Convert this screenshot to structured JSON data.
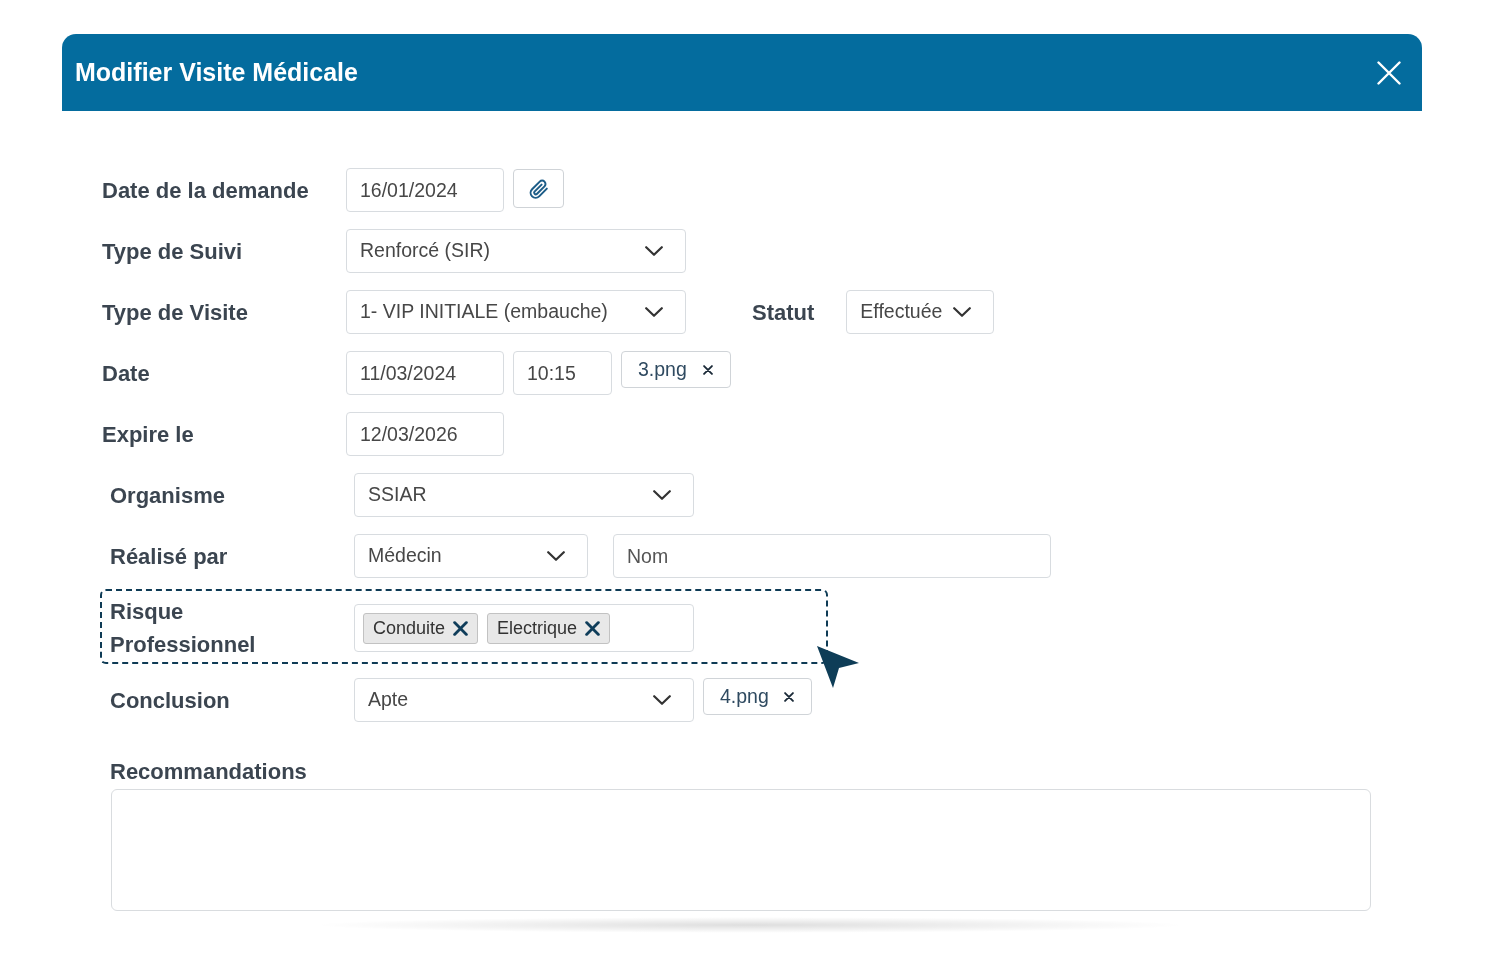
{
  "dialog": {
    "title": "Modifier Visite Médicale"
  },
  "form": {
    "rows": [
      {
        "label": "Date de la demande",
        "highlighted": false,
        "controls": [
          {
            "kind": "date",
            "value": "16/01/2024"
          },
          {
            "kind": "attach"
          }
        ]
      },
      {
        "label": "Type de Suivi",
        "highlighted": false,
        "controls": [
          {
            "kind": "select",
            "value": "Renforcé (SIR)"
          }
        ]
      },
      {
        "label": "Type de Visite",
        "highlighted": false,
        "controls": [
          {
            "kind": "select",
            "value": "1- VIP INITIALE (embauche)"
          },
          {
            "kind": "label",
            "text": "Statut"
          },
          {
            "kind": "select",
            "value": "Effectuée"
          }
        ]
      },
      {
        "label": "Date",
        "highlighted": false,
        "controls": [
          {
            "kind": "date",
            "value": "11/03/2024"
          },
          {
            "kind": "time",
            "value": "10:15"
          },
          {
            "kind": "file",
            "name": "3.png"
          }
        ]
      },
      {
        "label": "Expire le",
        "highlighted": false,
        "controls": [
          {
            "kind": "date",
            "value": "12/03/2026"
          }
        ]
      },
      {
        "label": "Organisme",
        "highlighted": false,
        "controls": [
          {
            "kind": "select",
            "value": "SSIAR"
          }
        ]
      },
      {
        "label": "Réalisé par",
        "highlighted": false,
        "controls": [
          {
            "kind": "select",
            "value": "Médecin"
          },
          {
            "kind": "text",
            "placeholder": "Nom"
          }
        ]
      },
      {
        "label": "Risque Professionnel",
        "highlighted": true,
        "controls": [
          {
            "kind": "tags",
            "tags": [
              "Conduite",
              "Electrique"
            ]
          }
        ]
      },
      {
        "label": "Conclusion",
        "highlighted": false,
        "controls": [
          {
            "kind": "select",
            "value": "Apte"
          },
          {
            "kind": "file",
            "name": "4.png"
          }
        ]
      }
    ]
  },
  "recommendations": {
    "label": "Recommandations"
  }
}
